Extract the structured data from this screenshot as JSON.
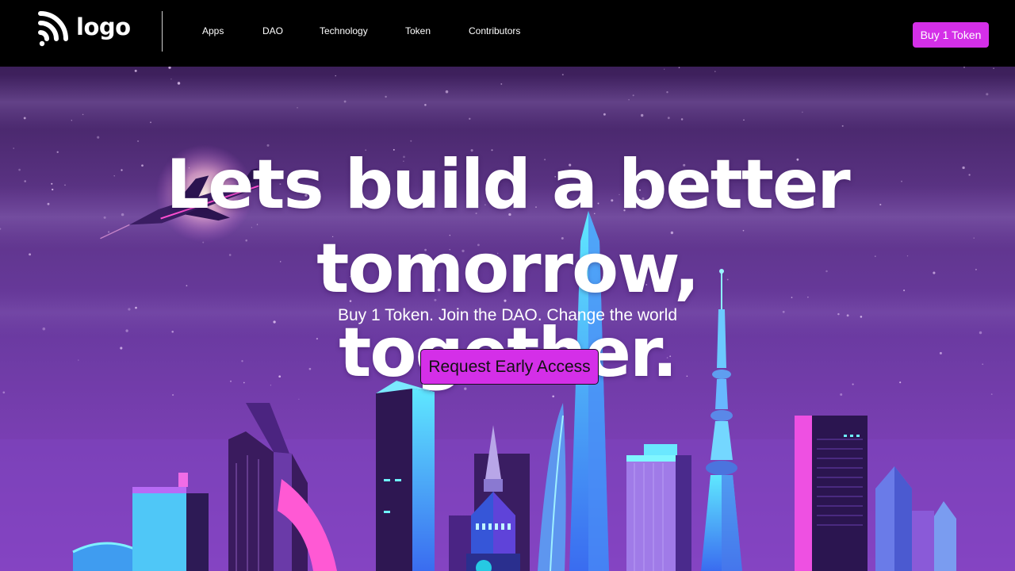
{
  "header": {
    "logo_text": "logo",
    "nav": [
      {
        "label": "Apps"
      },
      {
        "label": "DAO"
      },
      {
        "label": "Technology"
      },
      {
        "label": "Token"
      },
      {
        "label": "Contributors"
      }
    ],
    "buy_button": "Buy 1 Token"
  },
  "hero": {
    "headline_line1": "Lets build a better tomorrow,",
    "headline_line2": "together.",
    "subheadline": "Buy 1 Token. Join the DAO. Change the world",
    "cta_label": "Request Early Access"
  },
  "colors": {
    "accent": "#d42fe8",
    "header_bg": "#000000",
    "hero_sky_top": "#3c1f5a",
    "hero_sky_bottom": "#8a44c4"
  },
  "icons": {
    "logo": "wifi-signal-icon"
  }
}
